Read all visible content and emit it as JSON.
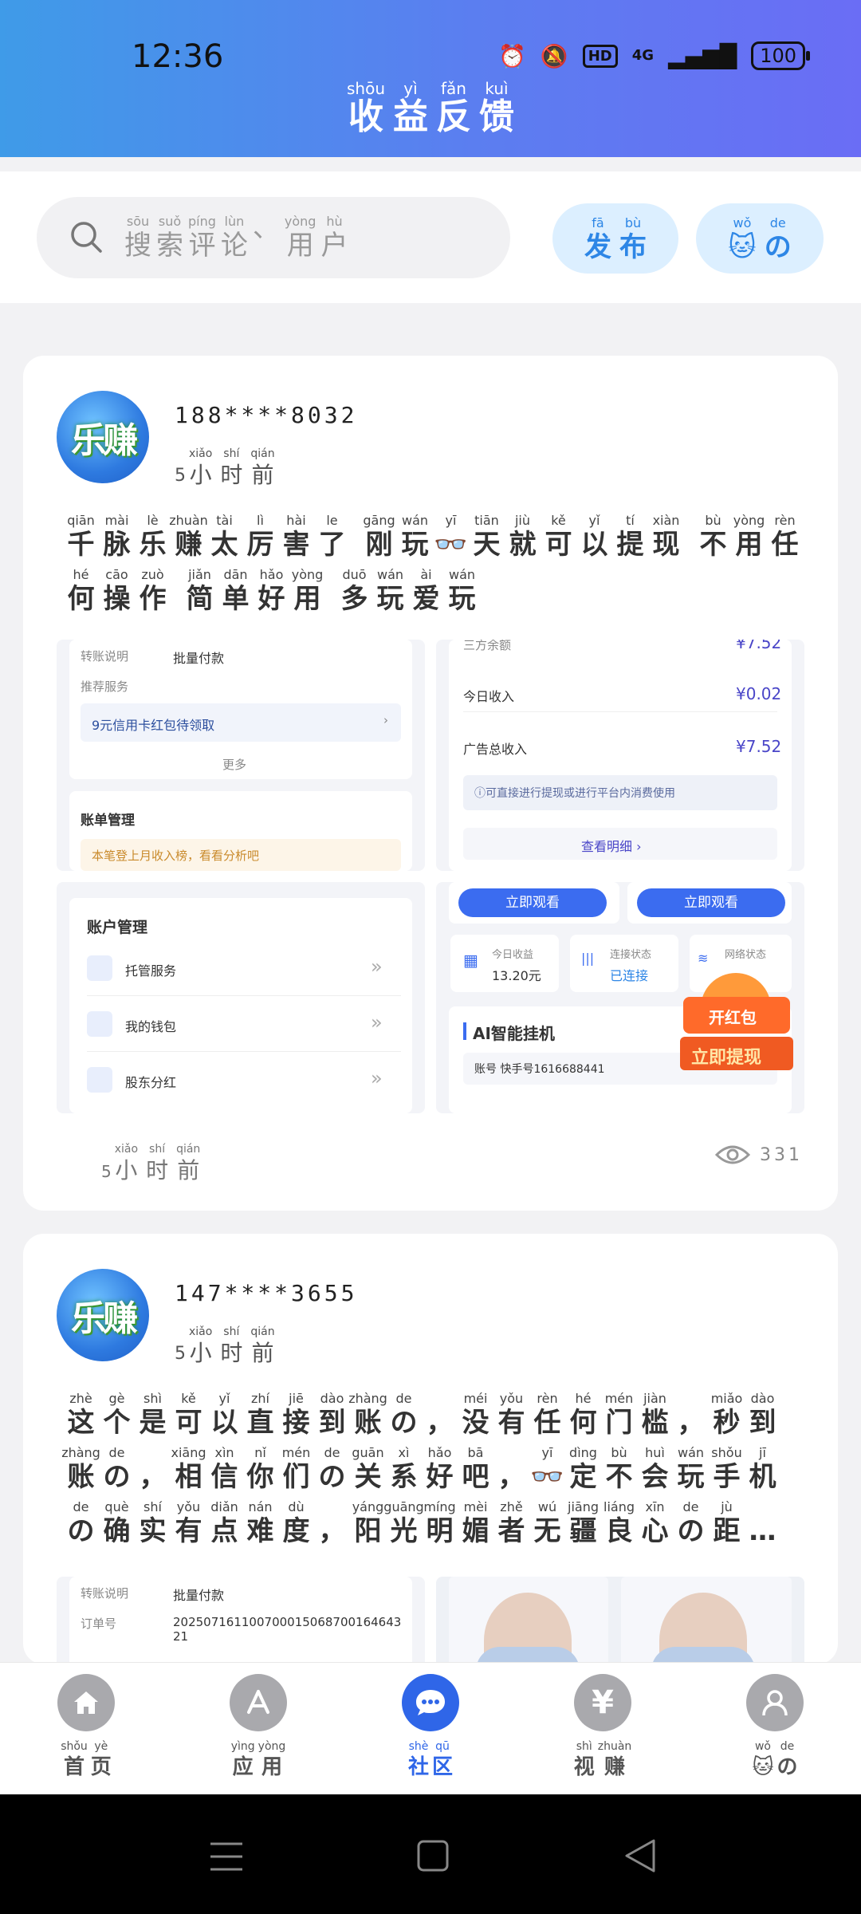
{
  "status_bar": {
    "time": "12:36",
    "battery": "100",
    "network": "4G",
    "hd": "HD"
  },
  "header": {
    "title_chars": [
      {
        "py": "shōu",
        "hz": "收"
      },
      {
        "py": "yì",
        "hz": "益"
      },
      {
        "py": "fǎn",
        "hz": "反"
      },
      {
        "py": "kuì",
        "hz": "馈"
      }
    ]
  },
  "search": {
    "placeholder_chars": [
      {
        "py": "sōu",
        "hz": "搜"
      },
      {
        "py": "suǒ",
        "hz": "索"
      },
      {
        "py": "píng",
        "hz": "评"
      },
      {
        "py": "lùn",
        "hz": "论"
      },
      {
        "py": "",
        "hz": "、"
      },
      {
        "py": "yòng",
        "hz": "用"
      },
      {
        "py": "hù",
        "hz": "户"
      }
    ],
    "publish_chars": [
      {
        "py": "fā",
        "hz": "发"
      },
      {
        "py": "bù",
        "hz": "布"
      }
    ],
    "mine_chars": [
      {
        "py": "wǒ",
        "hz": "🐱"
      },
      {
        "py": "de",
        "hz": "の"
      }
    ]
  },
  "posts": [
    {
      "avatar_text": "乐赚",
      "username": "188****8032",
      "time_num": "5",
      "time_chars": [
        {
          "py": "xiǎo",
          "hz": "小"
        },
        {
          "py": "shí",
          "hz": "时"
        },
        {
          "py": "qián",
          "hz": "前"
        }
      ],
      "views": "331",
      "lines": [
        [
          {
            "py": "qiān",
            "hz": "千"
          },
          {
            "py": "mài",
            "hz": "脉"
          },
          {
            "py": "lè",
            "hz": "乐"
          },
          {
            "py": "zhuàn",
            "hz": "赚"
          },
          {
            "py": "tài",
            "hz": "太"
          },
          {
            "py": "lì",
            "hz": "厉"
          },
          {
            "py": "hài",
            "hz": "害"
          },
          {
            "py": "le",
            "hz": "了"
          },
          {
            "py": "",
            "hz": " "
          },
          {
            "py": "gāng",
            "hz": "刚"
          },
          {
            "py": "wán",
            "hz": "玩"
          },
          {
            "py": "yī",
            "hz": "👓"
          },
          {
            "py": "tiān",
            "hz": "天"
          },
          {
            "py": "jiù",
            "hz": "就"
          },
          {
            "py": "kě",
            "hz": "可"
          },
          {
            "py": "yǐ",
            "hz": "以"
          },
          {
            "py": "tí",
            "hz": "提"
          },
          {
            "py": "xiàn",
            "hz": "现"
          },
          {
            "py": "",
            "hz": " "
          },
          {
            "py": "bù",
            "hz": "不"
          },
          {
            "py": "yòng",
            "hz": "用"
          },
          {
            "py": "rèn",
            "hz": "任"
          }
        ],
        [
          {
            "py": "hé",
            "hz": "何"
          },
          {
            "py": "cāo",
            "hz": "操"
          },
          {
            "py": "zuò",
            "hz": "作"
          },
          {
            "py": "",
            "hz": " "
          },
          {
            "py": "jiǎn",
            "hz": "简"
          },
          {
            "py": "dān",
            "hz": "单"
          },
          {
            "py": "hǎo",
            "hz": "好"
          },
          {
            "py": "yòng",
            "hz": "用"
          },
          {
            "py": "",
            "hz": " "
          },
          {
            "py": "duō",
            "hz": "多"
          },
          {
            "py": "wán",
            "hz": "玩"
          },
          {
            "py": "ài",
            "hz": "爱"
          },
          {
            "py": "wán",
            "hz": "玩"
          }
        ]
      ],
      "images": {
        "img1": {
          "transfer_label": "转账说明",
          "transfer_value": "批量付款",
          "recommend_label": "推荐服务",
          "offer": "9元信用卡红包待领取",
          "more": "更多",
          "bill_title": "账单管理",
          "bill_tip": "本笔登上月收入榜，看看分析吧"
        },
        "img2": {
          "row0_label": "三方余额",
          "row0_value": "¥7.52",
          "row1_label": "今日收入",
          "row1_value": "¥0.02",
          "row2_label": "广告总收入",
          "row2_value": "¥7.52",
          "note": "ⓘ可直接进行提现或进行平台内消费使用",
          "detail": "查看明细 ›"
        },
        "img3": {
          "title": "账户管理",
          "items": [
            "托管服务",
            "我的钱包",
            "股东分红"
          ]
        },
        "img4": {
          "watch1": "立即观看",
          "watch2": "立即观看",
          "earn_label": "今日收益",
          "earn_value": "13.20元",
          "conn_label": "连接状态",
          "conn_value": "已连接",
          "net_label": "网络状态",
          "ai_title": "AI智能挂机",
          "account": "账号  快手号1616688441",
          "badge_top": "开红包",
          "badge_bottom": "立即提现"
        }
      }
    },
    {
      "avatar_text": "乐赚",
      "username": "147****3655",
      "time_num": "5",
      "time_chars": [
        {
          "py": "xiǎo",
          "hz": "小"
        },
        {
          "py": "shí",
          "hz": "时"
        },
        {
          "py": "qián",
          "hz": "前"
        }
      ],
      "lines": [
        [
          {
            "py": "zhè",
            "hz": "这"
          },
          {
            "py": "gè",
            "hz": "个"
          },
          {
            "py": "shì",
            "hz": "是"
          },
          {
            "py": "kě",
            "hz": "可"
          },
          {
            "py": "yǐ",
            "hz": "以"
          },
          {
            "py": "zhí",
            "hz": "直"
          },
          {
            "py": "jiē",
            "hz": "接"
          },
          {
            "py": "dào",
            "hz": "到"
          },
          {
            "py": "zhàng",
            "hz": "账"
          },
          {
            "py": "de",
            "hz": "の"
          },
          {
            "py": "",
            "hz": "，"
          },
          {
            "py": "méi",
            "hz": "没"
          },
          {
            "py": "yǒu",
            "hz": "有"
          },
          {
            "py": "rèn",
            "hz": "任"
          },
          {
            "py": "hé",
            "hz": "何"
          },
          {
            "py": "mén",
            "hz": "门"
          },
          {
            "py": "jiàn",
            "hz": "槛"
          },
          {
            "py": "",
            "hz": "，"
          },
          {
            "py": "miǎo",
            "hz": "秒"
          },
          {
            "py": "dào",
            "hz": "到"
          }
        ],
        [
          {
            "py": "zhàng",
            "hz": "账"
          },
          {
            "py": "de",
            "hz": "の"
          },
          {
            "py": "",
            "hz": "，"
          },
          {
            "py": "xiāng",
            "hz": "相"
          },
          {
            "py": "xìn",
            "hz": "信"
          },
          {
            "py": "nǐ",
            "hz": "你"
          },
          {
            "py": "mén",
            "hz": "们"
          },
          {
            "py": "de",
            "hz": "の"
          },
          {
            "py": "guān",
            "hz": "关"
          },
          {
            "py": "xì",
            "hz": "系"
          },
          {
            "py": "hǎo",
            "hz": "好"
          },
          {
            "py": "bā",
            "hz": "吧"
          },
          {
            "py": "",
            "hz": "，"
          },
          {
            "py": "yī",
            "hz": "👓"
          },
          {
            "py": "dìng",
            "hz": "定"
          },
          {
            "py": "bù",
            "hz": "不"
          },
          {
            "py": "huì",
            "hz": "会"
          },
          {
            "py": "wán",
            "hz": "玩"
          },
          {
            "py": "shǒu",
            "hz": "手"
          },
          {
            "py": "jī",
            "hz": "机"
          }
        ],
        [
          {
            "py": "de",
            "hz": "の"
          },
          {
            "py": "què",
            "hz": "确"
          },
          {
            "py": "shí",
            "hz": "实"
          },
          {
            "py": "yǒu",
            "hz": "有"
          },
          {
            "py": "diǎn",
            "hz": "点"
          },
          {
            "py": "nán",
            "hz": "难"
          },
          {
            "py": "dù",
            "hz": "度"
          },
          {
            "py": "",
            "hz": "，"
          },
          {
            "py": "yáng",
            "hz": "阳"
          },
          {
            "py": "guāng",
            "hz": "光"
          },
          {
            "py": "míng",
            "hz": "明"
          },
          {
            "py": "mèi",
            "hz": "媚"
          },
          {
            "py": "zhě",
            "hz": "者"
          },
          {
            "py": "wú",
            "hz": "无"
          },
          {
            "py": "jiāng",
            "hz": "疆"
          },
          {
            "py": "liáng",
            "hz": "良"
          },
          {
            "py": "xīn",
            "hz": "心"
          },
          {
            "py": "de",
            "hz": "の"
          },
          {
            "py": "jù",
            "hz": "距"
          },
          {
            "py": "",
            "hz": "…"
          }
        ]
      ],
      "images": {
        "img1": {
          "transfer_label": "转账说明",
          "transfer_value": "批量付款",
          "order_label": "订单号",
          "order_value": "20250716110070001506870016464321"
        }
      }
    }
  ],
  "bottom_nav": [
    {
      "chars": [
        {
          "py": "shǒu",
          "hz": "首"
        },
        {
          "py": "yè",
          "hz": "页"
        }
      ],
      "icon": "home-icon",
      "active": false
    },
    {
      "chars": [
        {
          "py": "yìng",
          "hz": "应"
        },
        {
          "py": "yòng",
          "hz": "用"
        }
      ],
      "icon": "app-store-icon",
      "active": false
    },
    {
      "chars": [
        {
          "py": "shè",
          "hz": "社"
        },
        {
          "py": "qū",
          "hz": "区"
        }
      ],
      "icon": "chat-icon",
      "active": true
    },
    {
      "chars": [
        {
          "py": "shì",
          "hz": "视"
        },
        {
          "py": "zhuàn",
          "hz": "赚"
        }
      ],
      "icon": "yuan-icon",
      "active": false
    },
    {
      "chars": [
        {
          "py": "wǒ",
          "hz": "🐱"
        },
        {
          "py": "de",
          "hz": "の"
        }
      ],
      "icon": "user-icon",
      "active": false
    }
  ],
  "colors": {
    "header_start": "#3f9be8",
    "header_end": "#6a6df5",
    "accent": "#2f66e8",
    "pill_bg": "#dcefff"
  }
}
